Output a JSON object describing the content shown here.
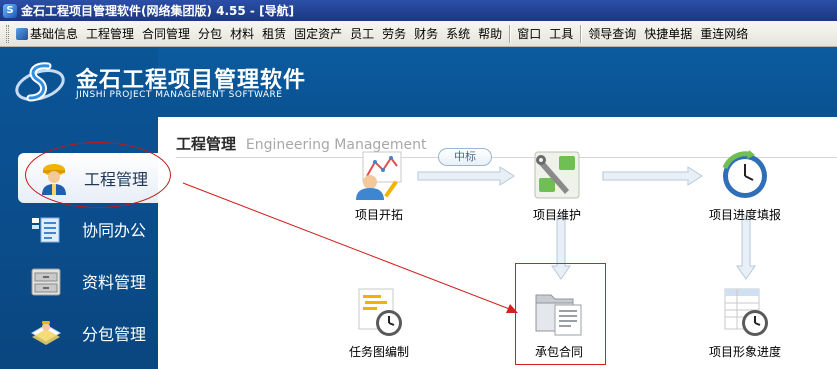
{
  "window": {
    "title": "金石工程项目管理软件(网络集团版) 4.55 - [导航]"
  },
  "menu": {
    "items": [
      "基础信息",
      "工程管理",
      "合同管理",
      "分包",
      "材料",
      "租赁",
      "固定资产",
      "员工",
      "劳务",
      "财务",
      "系统",
      "帮助"
    ],
    "window_items": [
      "窗口",
      "工具"
    ],
    "quick_items": [
      "领导查询",
      "快捷单据",
      "重连网络"
    ]
  },
  "brand": {
    "name_cn": "金石工程项目管理软件",
    "name_en": "JINSHI PROJECT MANAGEMENT SOFTWARE"
  },
  "sidebar": {
    "items": [
      {
        "label": "工程管理",
        "icon": "worker-icon",
        "active": true
      },
      {
        "label": "协同办公",
        "icon": "collaboration-icon",
        "active": false
      },
      {
        "label": "资料管理",
        "icon": "cabinet-icon",
        "active": false
      },
      {
        "label": "分包管理",
        "icon": "subcontract-icon",
        "active": false
      }
    ]
  },
  "content": {
    "title": "工程管理",
    "subtitle": "Engineering Management",
    "flow_pill": "中标",
    "tiles": {
      "project_expand": "项目开拓",
      "project_maintain": "项目维护",
      "progress_fill": "项目进度填报",
      "task_chart": "任务图编制",
      "contract": "承包合同",
      "image_progress": "项目形象进度"
    }
  },
  "colors": {
    "banner_blue": "#0a5291",
    "title_bar": "#1c3780",
    "annotation_red": "#d42020"
  }
}
